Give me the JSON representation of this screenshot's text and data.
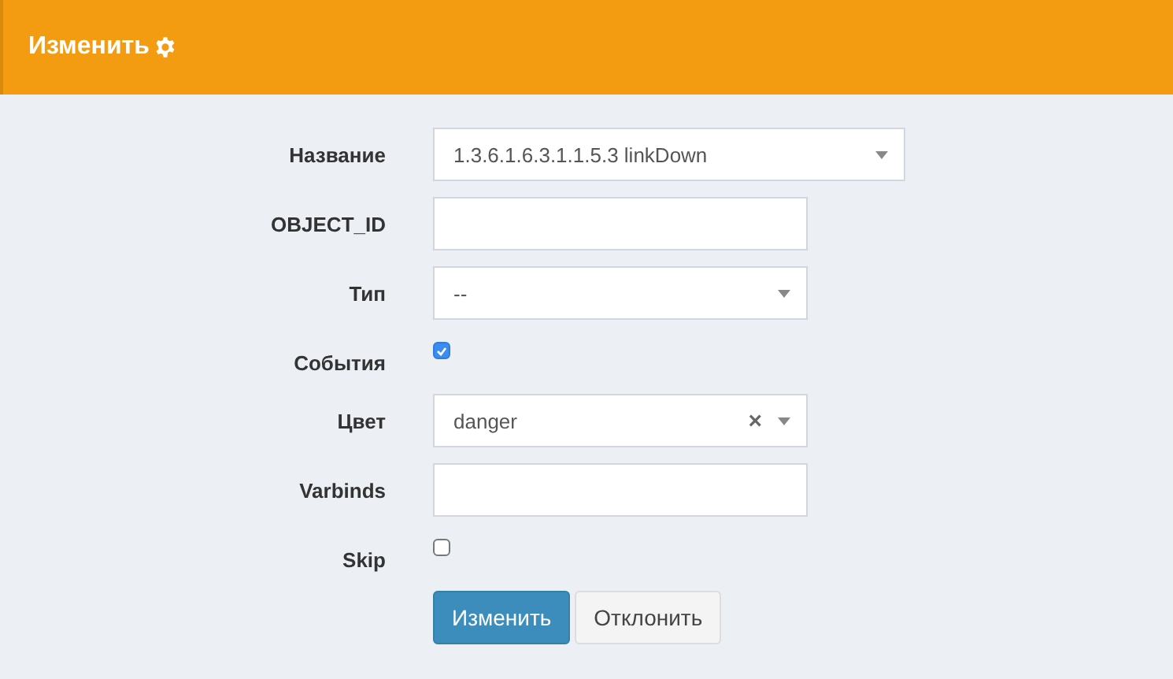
{
  "header": {
    "title": "Изменить"
  },
  "fields": [
    {
      "kind": "select",
      "label": "Название",
      "value": "1.3.6.1.6.3.1.1.5.3 linkDown",
      "wide": true
    },
    {
      "kind": "input",
      "label": "OBJECT_ID"
    },
    {
      "kind": "select",
      "label": "Тип",
      "value": "--"
    },
    {
      "kind": "checkbox",
      "label": "События",
      "checked": true
    },
    {
      "kind": "select",
      "label": "Цвет",
      "value": "danger",
      "clear": "×"
    },
    {
      "kind": "input",
      "label": "Varbinds"
    },
    {
      "kind": "checkbox",
      "label": "Skip",
      "checked": false
    }
  ],
  "buttons": [
    {
      "label": "Изменить",
      "kind": "primary"
    },
    {
      "label": "Отклонить",
      "kind": "default"
    }
  ]
}
